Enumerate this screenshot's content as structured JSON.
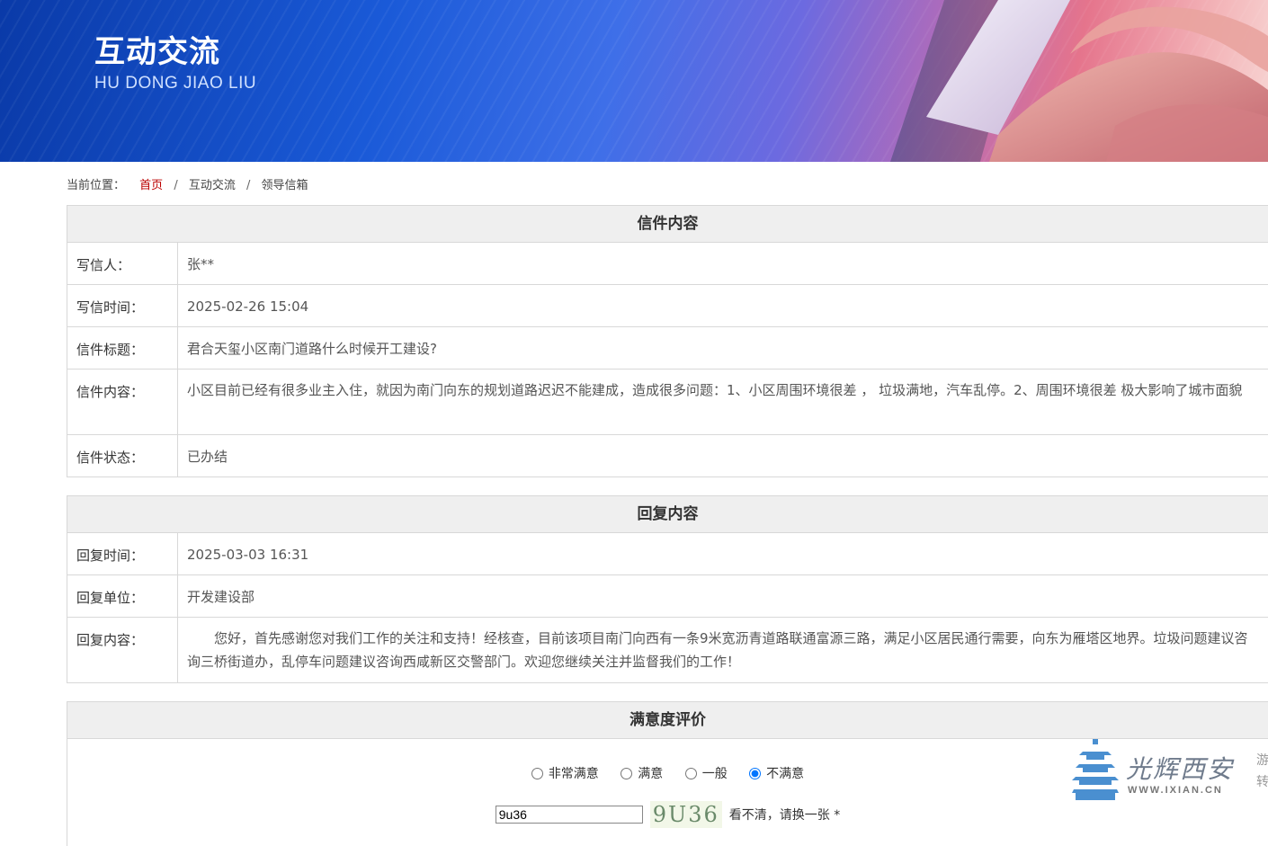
{
  "banner": {
    "title": "互动交流",
    "subtitle": "HU DONG JIAO LIU"
  },
  "breadcrumb": {
    "prefix": "当前位置：",
    "items": [
      "首页",
      "互动交流",
      "领导信箱"
    ],
    "separator": "/"
  },
  "letter": {
    "heading": "信件内容",
    "rows": [
      {
        "label": "写信人：",
        "value": "张**"
      },
      {
        "label": "写信时间：",
        "value": "2025-02-26 15:04"
      },
      {
        "label": "信件标题：",
        "value": "君合天玺小区南门道路什么时候开工建设?"
      },
      {
        "label": "信件内容：",
        "value": "小区目前已经有很多业主入住，就因为南门向东的规划道路迟迟不能建成，造成很多问题：1、小区周围环境很差 ， 垃圾满地，汽车乱停。2、周围环境很差 极大影响了城市面貌"
      },
      {
        "label": "信件状态：",
        "value": "已办结"
      }
    ]
  },
  "reply": {
    "heading": "回复内容",
    "rows": [
      {
        "label": "回复时间：",
        "value": "2025-03-03 16:31"
      },
      {
        "label": "回复单位：",
        "value": "开发建设部"
      },
      {
        "label": "回复内容：",
        "value": "您好，首先感谢您对我们工作的关注和支持！经核查，目前该项目南门向西有一条9米宽沥青道路联通富源三路，满足小区居民通行需要，向东为雁塔区地界。垃圾问题建议咨询三桥街道办，乱停车问题建议咨询西咸新区交警部门。欢迎您继续关注并监督我们的工作！"
      }
    ]
  },
  "rating": {
    "heading": "满意度评价",
    "options": [
      "非常满意",
      "满意",
      "一般",
      "不满意"
    ],
    "selected_index": 3,
    "captcha_value": "9u36",
    "captcha_image_text": "9U36",
    "refresh_label": "看不清，请换一张",
    "required_mark": "*"
  },
  "watermark": {
    "brand": "光辉西安",
    "url": "WWW.IXIAN.CN",
    "edge_chars": "游\n转"
  },
  "colors": {
    "accent_red": "#bb0000",
    "panel_header_bg": "#efefef",
    "border": "#d8d8d8"
  }
}
